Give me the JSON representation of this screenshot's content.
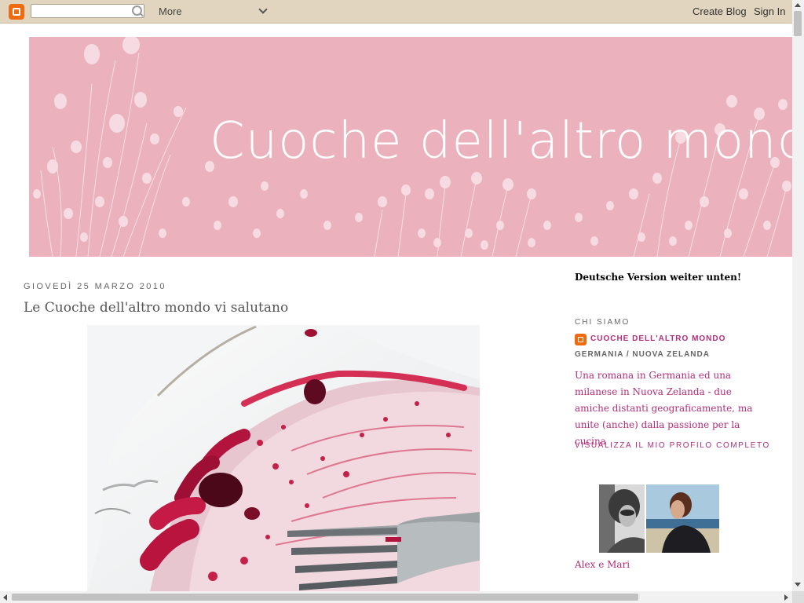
{
  "navbar": {
    "logo_icon": "blogger-logo-icon",
    "search_placeholder": "",
    "search_icon": "search-icon",
    "more_label": "More",
    "create_blog_label": "Create Blog",
    "sign_in_label": "Sign In"
  },
  "header": {
    "title": "Cuoche dell'altro mondo",
    "background_color": "#ebb1bd"
  },
  "post": {
    "date": "Giovedì 25 marzo 2010",
    "title": "Le Cuoche dell'altro mondo vi salutano",
    "image_icon": "plate-with-fork-image"
  },
  "sidebar": {
    "notice": "Deutsche Version weiter unten!",
    "about_heading": "CHI SIAMO",
    "profile_name": "CUOCHE DELL'ALTRO MONDO",
    "location": "GERMANIA / NUOVA ZELANDA",
    "about_text": "Una romana in Germania ed una milanese in Nuova Zelanda - due amiche distanti geograficamente, ma unite (anche) dalla passione per la cucina",
    "full_profile_link": "VISUALIZZA IL MIO PROFILO COMPLETO",
    "photo_caption": "Alex e Mari"
  },
  "colors": {
    "accent": "#b12e7b",
    "navbar_bg": "#e2d5bf",
    "blogger_orange": "#f06a0f"
  }
}
